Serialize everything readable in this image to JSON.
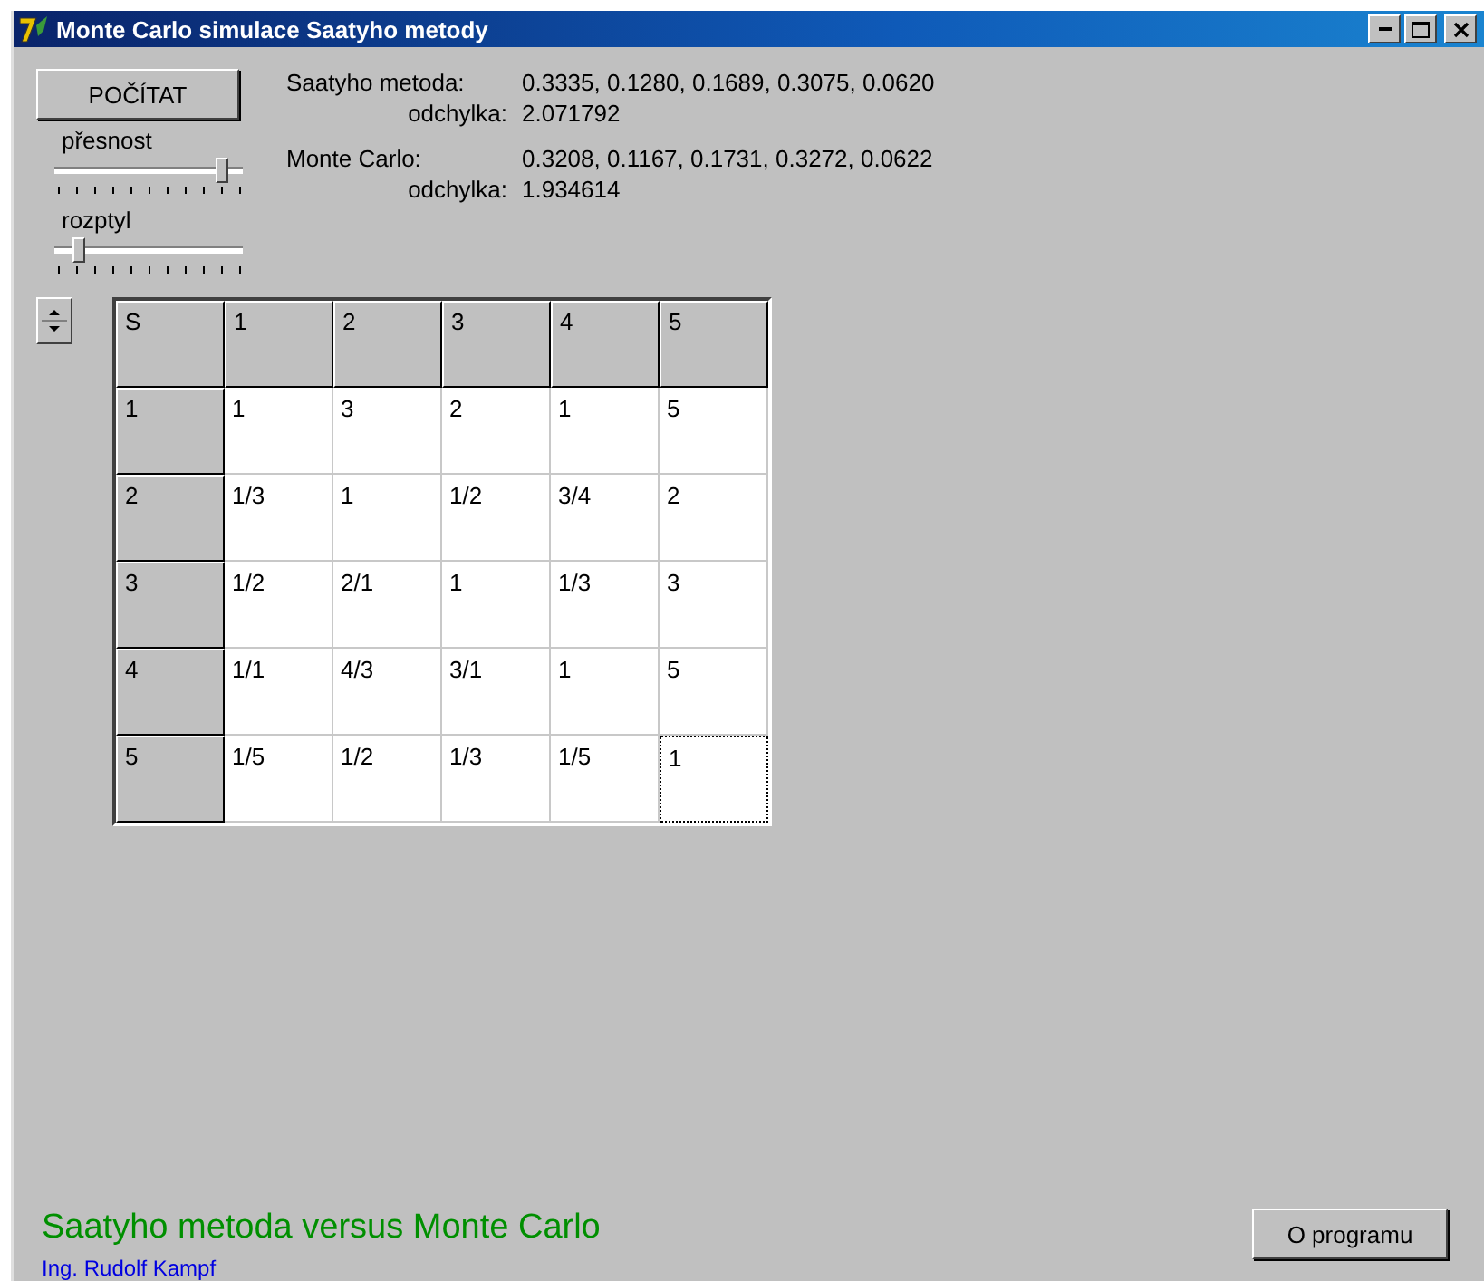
{
  "window": {
    "title": "Monte Carlo simulace Saatyho metody"
  },
  "compute_button": "POČÍTAT",
  "sliders": [
    {
      "label": "přesnost",
      "level": 0.93
    },
    {
      "label": "rozptyl",
      "level": 0.1
    }
  ],
  "results": [
    {
      "label": "Saatyho metoda:",
      "value": "0.3335, 0.1280, 0.1689, 0.3075, 0.0620",
      "deviation_label": "odchylka:",
      "deviation": "2.071792"
    },
    {
      "label": "Monte Carlo:",
      "value": "0.3208, 0.1167, 0.1731, 0.3272, 0.0622",
      "deviation_label": "odchylka:",
      "deviation": "1.934614"
    }
  ],
  "grid": {
    "corner": "S",
    "columns": [
      "1",
      "2",
      "3",
      "4",
      "5"
    ],
    "rows": [
      {
        "header": "1",
        "cells": [
          {
            "text": "1",
            "selected": false
          },
          {
            "text": "3",
            "selected": false
          },
          {
            "text": "2",
            "selected": false
          },
          {
            "text": "1",
            "selected": false
          },
          {
            "text": "5",
            "selected": false
          }
        ]
      },
      {
        "header": "2",
        "cells": [
          {
            "text": "1/3",
            "selected": false
          },
          {
            "text": "1",
            "selected": false
          },
          {
            "text": "1/2",
            "selected": false
          },
          {
            "text": "3/4",
            "selected": false
          },
          {
            "text": "2",
            "selected": false
          }
        ]
      },
      {
        "header": "3",
        "cells": [
          {
            "text": "1/2",
            "selected": false
          },
          {
            "text": "2/1",
            "selected": false
          },
          {
            "text": "1",
            "selected": false
          },
          {
            "text": "1/3",
            "selected": false
          },
          {
            "text": "3",
            "selected": false
          }
        ]
      },
      {
        "header": "4",
        "cells": [
          {
            "text": "1/1",
            "selected": false
          },
          {
            "text": "4/3",
            "selected": false
          },
          {
            "text": "3/1",
            "selected": false
          },
          {
            "text": "1",
            "selected": false
          },
          {
            "text": "5",
            "selected": false
          }
        ]
      },
      {
        "header": "5",
        "cells": [
          {
            "text": "1/5",
            "selected": false
          },
          {
            "text": "1/2",
            "selected": false
          },
          {
            "text": "1/3",
            "selected": false
          },
          {
            "text": "1/5",
            "selected": false
          },
          {
            "text": "1",
            "selected": true
          }
        ]
      }
    ]
  },
  "footer": {
    "title": "Saatyho metoda versus Monte Carlo",
    "author": "Ing. Rudolf Kampf",
    "about_button": "O programu"
  }
}
